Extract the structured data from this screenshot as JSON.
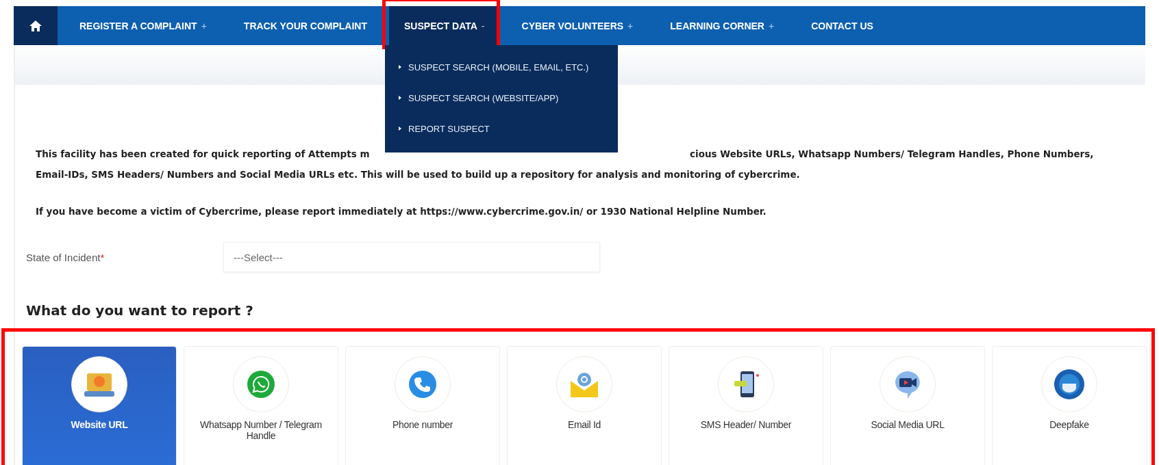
{
  "nav": {
    "items": [
      {
        "label": "REGISTER A COMPLAINT",
        "sign": "+",
        "expanded": false
      },
      {
        "label": "TRACK YOUR COMPLAINT",
        "expanded": false
      },
      {
        "label": "SUSPECT DATA",
        "sign": "-",
        "expanded": true,
        "highlighted": true,
        "menu": [
          "SUSPECT SEARCH (MOBILE, EMAIL, ETC.)",
          "SUSPECT SEARCH (WEBSITE/APP)",
          "REPORT SUSPECT"
        ]
      },
      {
        "label": "CYBER VOLUNTEERS",
        "sign": "+",
        "expanded": false
      },
      {
        "label": "LEARNING CORNER",
        "sign": "+",
        "expanded": false
      },
      {
        "label": "CONTACT US",
        "expanded": false
      }
    ]
  },
  "intro": {
    "line_1_start": "This facility has been created for quick reporting of Attempts m",
    "line_1_end": "cious Website URLs, Whatsapp Numbers/ Telegram Handles, Phone Numbers,",
    "line_2": "Email-IDs, SMS Headers/ Numbers and Social Media URLs etc. This will be used to build up a repository for analysis and monitoring of cybercrime.",
    "notice": "If you have become a victim of Cybercrime, please report immediately at https://www.cybercrime.gov.in/ or 1930 National Helpline Number."
  },
  "form": {
    "label": "State of Incident",
    "required_mark": "*",
    "placeholder": "---Select---"
  },
  "report": {
    "heading": "What do you want to report ?",
    "highlighted": true,
    "options": [
      {
        "kind": "website",
        "label": "Website URL",
        "selected": true
      },
      {
        "kind": "whatsapp",
        "label": "Whatsapp Number / Telegram Handle",
        "selected": false
      },
      {
        "kind": "phone",
        "label": "Phone number",
        "selected": false
      },
      {
        "kind": "email",
        "label": "Email Id",
        "selected": false
      },
      {
        "kind": "sms",
        "label": "SMS Header/ Number",
        "selected": false
      },
      {
        "kind": "social",
        "label": "Social Media URL",
        "selected": false
      },
      {
        "kind": "deepfake",
        "label": "Deepfake",
        "selected": false
      }
    ]
  }
}
